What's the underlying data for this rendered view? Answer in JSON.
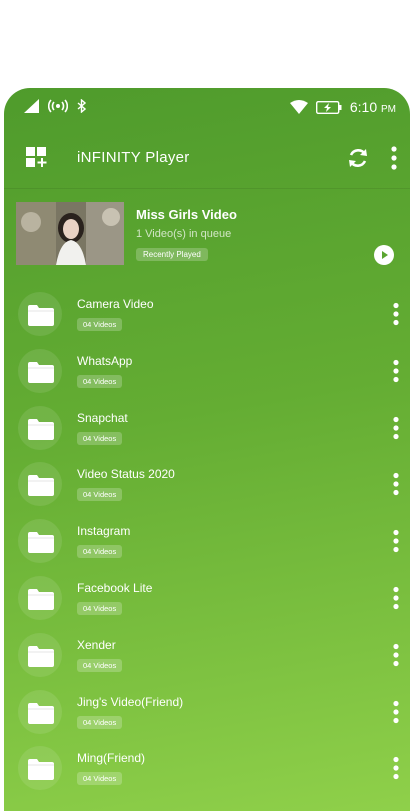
{
  "status_bar": {
    "time": "6:10",
    "ampm": "PM"
  },
  "header": {
    "title": "iNFINITY Player"
  },
  "recent": {
    "title": "Miss Girls Video",
    "subtitle": "1 Video(s) in queue",
    "badge": "Recently Played"
  },
  "folders": [
    {
      "name": "Camera Video",
      "count": "04 Videos"
    },
    {
      "name": "WhatsApp",
      "count": "04 Videos"
    },
    {
      "name": "Snapchat",
      "count": "04 Videos"
    },
    {
      "name": "Video Status 2020",
      "count": "04 Videos"
    },
    {
      "name": "Instagram",
      "count": "04 Videos"
    },
    {
      "name": "Facebook Lite",
      "count": "04 Videos"
    },
    {
      "name": "Xender",
      "count": "04 Videos"
    },
    {
      "name": "Jing's Video(Friend)",
      "count": "04 Videos"
    },
    {
      "name": "Ming(Friend)",
      "count": "04 Videos"
    }
  ],
  "icons": {
    "status": [
      "signal-icon",
      "hotspot-icon",
      "bluetooth-icon",
      "wifi-icon",
      "battery-icon"
    ],
    "header": [
      "apps-add-icon",
      "refresh-icon",
      "more-vertical-icon"
    ],
    "folder": "folder-icon",
    "play": "play-icon"
  },
  "colors": {
    "accent_start": "#4f9b2c",
    "accent_end": "#8fd04a"
  }
}
